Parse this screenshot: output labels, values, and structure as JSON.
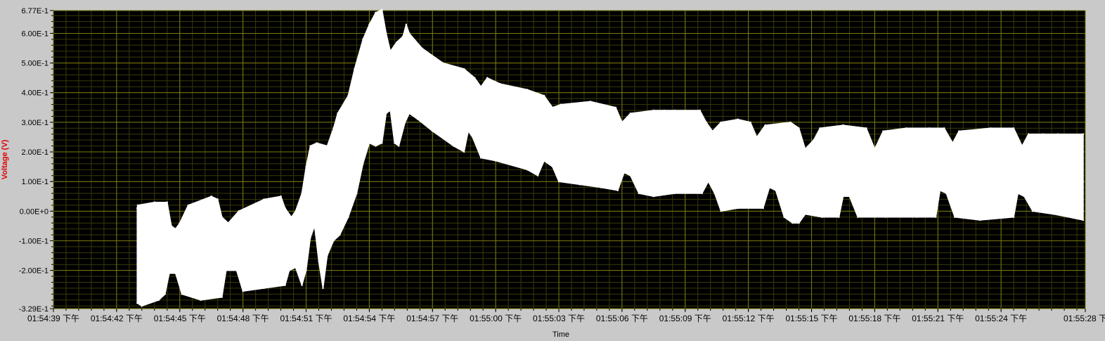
{
  "chart_data": {
    "type": "area",
    "title": "",
    "xlabel": "Time",
    "ylabel": "Voltage (V)",
    "ylim": [
      -0.329,
      0.677
    ],
    "grid": true,
    "background": "#000000",
    "grid_color": "#7a7a10",
    "subgrid_color": "#3a3a08",
    "trace_color": "#ffffff",
    "ylabel_color": "#e00000",
    "y_ticks": [
      {
        "value": 0.677,
        "label": "6.77E-1"
      },
      {
        "value": 0.6,
        "label": "6.00E-1"
      },
      {
        "value": 0.5,
        "label": "5.00E-1"
      },
      {
        "value": 0.4,
        "label": "4.00E-1"
      },
      {
        "value": 0.3,
        "label": "3.00E-1"
      },
      {
        "value": 0.2,
        "label": "2.00E-1"
      },
      {
        "value": 0.1,
        "label": "1.00E-1"
      },
      {
        "value": 0.0,
        "label": "0.00E+0"
      },
      {
        "value": -0.1,
        "label": "-1.00E-1"
      },
      {
        "value": -0.2,
        "label": "-2.00E-1"
      },
      {
        "value": -0.329,
        "label": "-3.29E-1"
      }
    ],
    "x_ticks": [
      {
        "value": 0,
        "label": "01:54:39 下午"
      },
      {
        "value": 3,
        "label": "01:54:42 下午"
      },
      {
        "value": 6,
        "label": "01:54:45 下午"
      },
      {
        "value": 9,
        "label": "01:54:48 下午"
      },
      {
        "value": 12,
        "label": "01:54:51 下午"
      },
      {
        "value": 15,
        "label": "01:54:54 下午"
      },
      {
        "value": 18,
        "label": "01:54:57 下午"
      },
      {
        "value": 21,
        "label": "01:55:00 下午"
      },
      {
        "value": 24,
        "label": "01:55:03 下午"
      },
      {
        "value": 27,
        "label": "01:55:06 下午"
      },
      {
        "value": 30,
        "label": "01:55:09 下午"
      },
      {
        "value": 33,
        "label": "01:55:12 下午"
      },
      {
        "value": 36,
        "label": "01:55:15 下午"
      },
      {
        "value": 39,
        "label": "01:55:18 下午"
      },
      {
        "value": 42,
        "label": "01:55:21 下午"
      },
      {
        "value": 45,
        "label": "01:55:24 下午"
      },
      {
        "value": 49,
        "label": "01:55:28 下"
      }
    ],
    "series": [
      {
        "upper_envelope": [
          [
            3.98,
            0.01
          ],
          [
            4.0,
            0.02
          ],
          [
            4.8,
            0.03
          ],
          [
            5.4,
            0.03
          ],
          [
            5.6,
            -0.05
          ],
          [
            5.8,
            -0.06
          ],
          [
            6.0,
            -0.04
          ],
          [
            6.4,
            0.02
          ],
          [
            7.5,
            0.05
          ],
          [
            7.8,
            0.04
          ],
          [
            8.0,
            -0.02
          ],
          [
            8.3,
            -0.04
          ],
          [
            8.8,
            0.0
          ],
          [
            10.0,
            0.04
          ],
          [
            10.8,
            0.05
          ],
          [
            11.0,
            0.01
          ],
          [
            11.3,
            -0.02
          ],
          [
            11.5,
            0.0
          ],
          [
            11.8,
            0.06
          ],
          [
            12.0,
            0.15
          ],
          [
            12.2,
            0.22
          ],
          [
            12.5,
            0.23
          ],
          [
            13.0,
            0.22
          ],
          [
            13.3,
            0.28
          ],
          [
            13.5,
            0.33
          ],
          [
            14.0,
            0.39
          ],
          [
            14.3,
            0.48
          ],
          [
            14.7,
            0.58
          ],
          [
            15.0,
            0.63
          ],
          [
            15.3,
            0.67
          ],
          [
            15.6,
            0.68
          ],
          [
            15.8,
            0.6
          ],
          [
            16.0,
            0.54
          ],
          [
            16.3,
            0.57
          ],
          [
            16.6,
            0.59
          ],
          [
            16.75,
            0.63
          ],
          [
            16.9,
            0.6
          ],
          [
            17.5,
            0.55
          ],
          [
            18.5,
            0.5
          ],
          [
            19.5,
            0.48
          ],
          [
            20.0,
            0.45
          ],
          [
            20.3,
            0.42
          ],
          [
            20.6,
            0.45
          ],
          [
            21.2,
            0.43
          ],
          [
            22.5,
            0.41
          ],
          [
            23.3,
            0.39
          ],
          [
            23.7,
            0.35
          ],
          [
            24.1,
            0.36
          ],
          [
            25.5,
            0.37
          ],
          [
            26.7,
            0.35
          ],
          [
            27.0,
            0.3
          ],
          [
            27.4,
            0.33
          ],
          [
            28.5,
            0.34
          ],
          [
            29.0,
            0.34
          ],
          [
            29.5,
            0.34
          ],
          [
            30.7,
            0.34
          ],
          [
            31.0,
            0.3
          ],
          [
            31.3,
            0.27
          ],
          [
            31.7,
            0.3
          ],
          [
            32.5,
            0.31
          ],
          [
            33.1,
            0.3
          ],
          [
            33.4,
            0.25
          ],
          [
            33.8,
            0.29
          ],
          [
            35.0,
            0.3
          ],
          [
            35.4,
            0.28
          ],
          [
            35.7,
            0.21
          ],
          [
            36.1,
            0.24
          ],
          [
            36.4,
            0.28
          ],
          [
            37.5,
            0.29
          ],
          [
            38.6,
            0.28
          ],
          [
            39.0,
            0.21
          ],
          [
            39.4,
            0.27
          ],
          [
            40.5,
            0.28
          ],
          [
            41.6,
            0.28
          ],
          [
            42.3,
            0.28
          ],
          [
            42.7,
            0.23
          ],
          [
            43.0,
            0.27
          ],
          [
            44.5,
            0.28
          ],
          [
            45.6,
            0.28
          ],
          [
            46.0,
            0.22
          ],
          [
            46.3,
            0.26
          ],
          [
            47.0,
            0.26
          ],
          [
            47.7,
            0.26
          ],
          [
            48.9,
            0.26
          ]
        ],
        "lower_envelope": [
          [
            3.98,
            -0.31
          ],
          [
            4.2,
            -0.32
          ],
          [
            5.0,
            -0.3
          ],
          [
            5.3,
            -0.28
          ],
          [
            5.5,
            -0.21
          ],
          [
            5.8,
            -0.21
          ],
          [
            6.1,
            -0.28
          ],
          [
            7.0,
            -0.3
          ],
          [
            8.0,
            -0.29
          ],
          [
            8.2,
            -0.2
          ],
          [
            8.7,
            -0.2
          ],
          [
            9.0,
            -0.27
          ],
          [
            10.0,
            -0.26
          ],
          [
            11.0,
            -0.25
          ],
          [
            11.2,
            -0.2
          ],
          [
            11.5,
            -0.19
          ],
          [
            11.8,
            -0.25
          ],
          [
            12.0,
            -0.2
          ],
          [
            12.2,
            -0.09
          ],
          [
            12.4,
            -0.05
          ],
          [
            12.6,
            -0.17
          ],
          [
            12.8,
            -0.26
          ],
          [
            13.0,
            -0.15
          ],
          [
            13.3,
            -0.1
          ],
          [
            13.6,
            -0.08
          ],
          [
            14.0,
            -0.02
          ],
          [
            14.4,
            0.06
          ],
          [
            14.7,
            0.16
          ],
          [
            15.0,
            0.23
          ],
          [
            15.3,
            0.22
          ],
          [
            15.6,
            0.23
          ],
          [
            15.8,
            0.33
          ],
          [
            16.0,
            0.34
          ],
          [
            16.2,
            0.23
          ],
          [
            16.4,
            0.22
          ],
          [
            16.7,
            0.3
          ],
          [
            16.9,
            0.33
          ],
          [
            17.3,
            0.31
          ],
          [
            18.0,
            0.27
          ],
          [
            19.0,
            0.22
          ],
          [
            19.5,
            0.2
          ],
          [
            19.7,
            0.27
          ],
          [
            19.9,
            0.25
          ],
          [
            20.3,
            0.18
          ],
          [
            21.0,
            0.17
          ],
          [
            22.5,
            0.14
          ],
          [
            23.0,
            0.12
          ],
          [
            23.3,
            0.17
          ],
          [
            23.7,
            0.15
          ],
          [
            24.0,
            0.1
          ],
          [
            25.0,
            0.09
          ],
          [
            26.0,
            0.08
          ],
          [
            26.8,
            0.07
          ],
          [
            27.1,
            0.13
          ],
          [
            27.4,
            0.12
          ],
          [
            27.8,
            0.06
          ],
          [
            28.5,
            0.05
          ],
          [
            29.5,
            0.06
          ],
          [
            30.8,
            0.06
          ],
          [
            31.1,
            0.1
          ],
          [
            31.4,
            0.06
          ],
          [
            31.7,
            0.0
          ],
          [
            32.5,
            0.01
          ],
          [
            33.7,
            0.01
          ],
          [
            34.0,
            0.08
          ],
          [
            34.3,
            0.07
          ],
          [
            34.7,
            -0.02
          ],
          [
            35.1,
            -0.04
          ],
          [
            35.4,
            -0.04
          ],
          [
            35.7,
            -0.01
          ],
          [
            36.5,
            -0.02
          ],
          [
            37.3,
            -0.02
          ],
          [
            37.5,
            0.05
          ],
          [
            37.8,
            0.05
          ],
          [
            38.2,
            -0.02
          ],
          [
            39.5,
            -0.02
          ],
          [
            41.0,
            -0.02
          ],
          [
            41.9,
            -0.02
          ],
          [
            42.1,
            0.07
          ],
          [
            42.4,
            0.06
          ],
          [
            42.8,
            -0.02
          ],
          [
            44.0,
            -0.03
          ],
          [
            45.6,
            -0.02
          ],
          [
            45.8,
            0.06
          ],
          [
            46.1,
            0.05
          ],
          [
            46.5,
            0.0
          ],
          [
            47.5,
            -0.01
          ],
          [
            48.9,
            -0.03
          ]
        ]
      }
    ]
  }
}
